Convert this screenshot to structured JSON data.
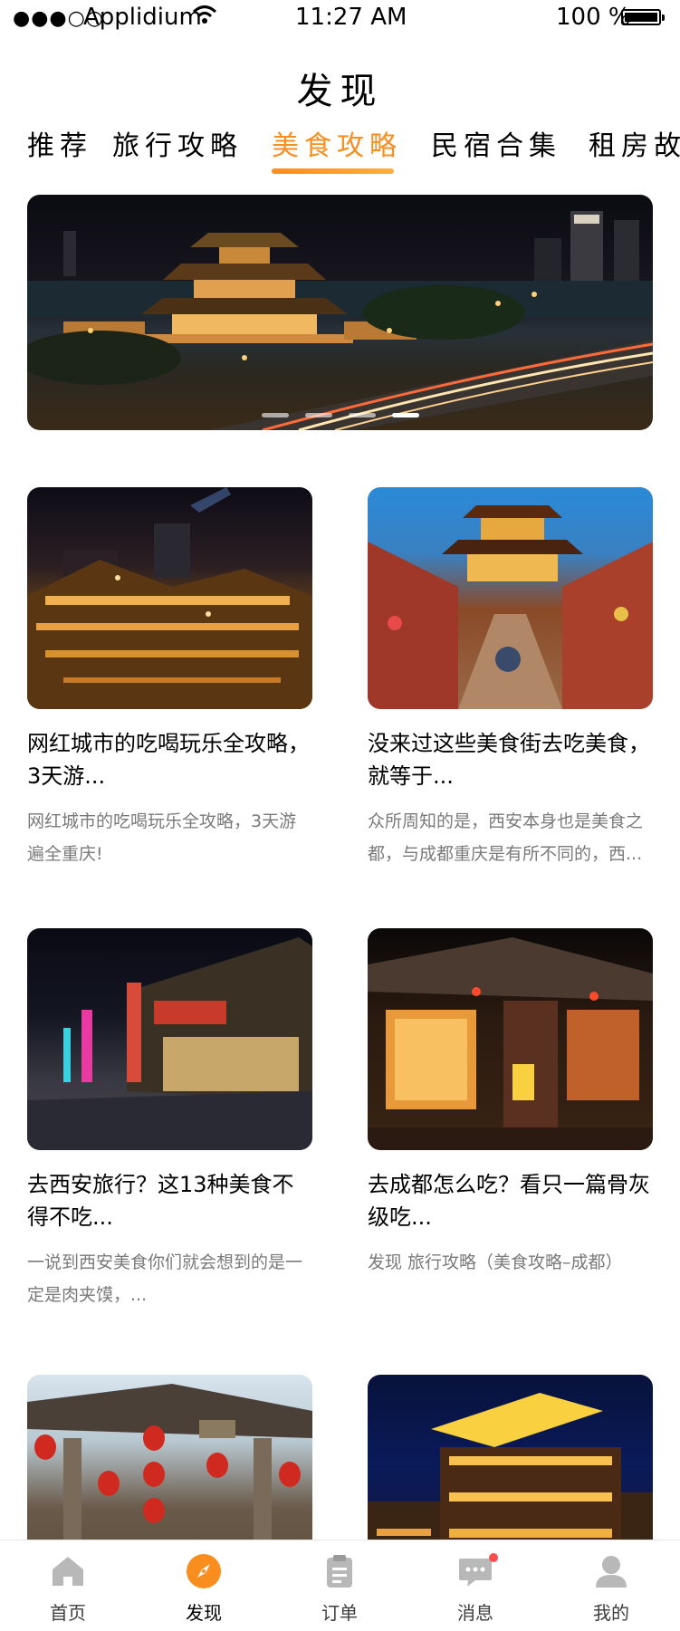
{
  "status_bar": {
    "signal": "●●●○○",
    "carrier": "Applidium",
    "time": "11:27 AM",
    "battery": "100 %"
  },
  "title": "发现",
  "tabs": [
    {
      "label": "推荐"
    },
    {
      "label": "旅行攻略"
    },
    {
      "label": "美食攻略"
    },
    {
      "label": "民宿合集"
    },
    {
      "label": "租房故"
    }
  ],
  "active_tab": "美食攻略",
  "colors": {
    "accent": "#f98d1e",
    "gradient_start": "#fb8d1e",
    "gradient_end": "#feae3f",
    "tabbar_text": "#3d3d3d",
    "text_primary": "#000000"
  },
  "banner": {
    "slide_count": 4,
    "active_slide": 4
  },
  "cards": [
    {
      "title": "网红城市的吃喝玩乐全攻略，3天游...",
      "desc": "网红城市的吃喝玩乐全攻略，3天游遍全重庆!"
    },
    {
      "title": " 没来过这些美食街去吃美食，就等于...",
      "desc": "众所周知的是，西安本身也是美食之都，与成都重庆是有所不同的，西..."
    },
    {
      "title": "去西安旅行？这13种美食不得不吃...",
      "desc": "一说到西安美食你们就会想到的是一定是肉夹馍，..."
    },
    {
      "title": "去成都怎么吃？看只一篇骨灰级吃...",
      "desc": "发现 旅行攻略（美食攻略–成都）"
    },
    {
      "title": "",
      "desc": ""
    },
    {
      "title": "",
      "desc": ""
    }
  ],
  "tabbar": [
    {
      "label": "首页",
      "icon": "home-icon"
    },
    {
      "label": "发现",
      "icon": "compass-icon"
    },
    {
      "label": "订单",
      "icon": "clipboard-icon"
    },
    {
      "label": "消息",
      "icon": "chat-icon"
    },
    {
      "label": "我的",
      "icon": "user-icon"
    }
  ]
}
